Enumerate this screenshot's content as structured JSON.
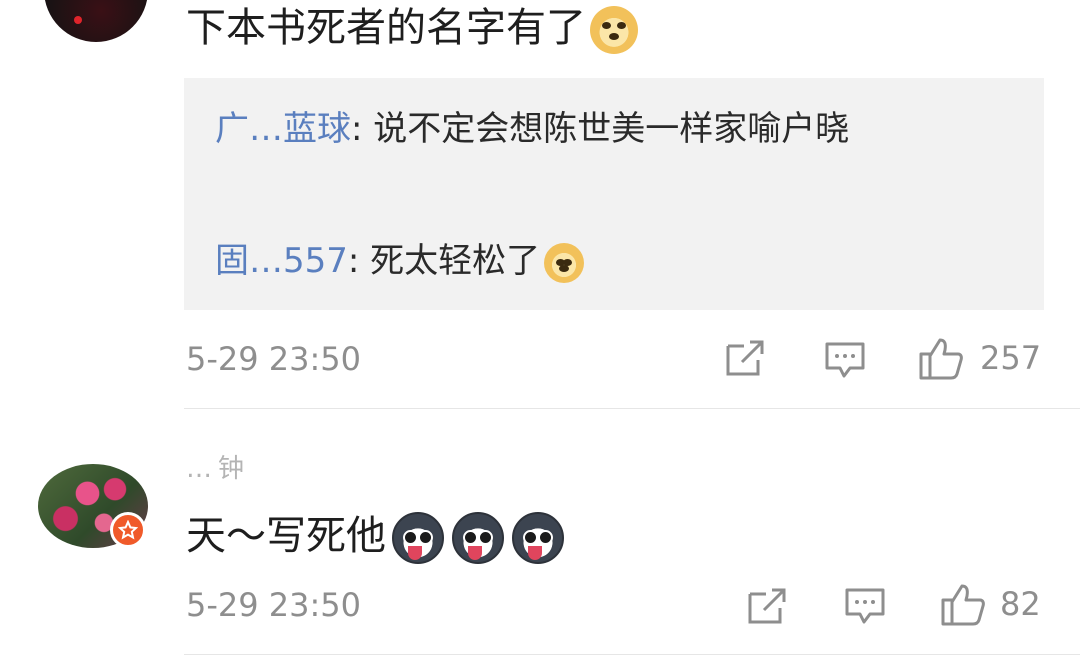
{
  "comments": [
    {
      "text": "下本书死者的名字有了",
      "emoji": "doge-icon",
      "replies": [
        {
          "user": "广…蓝球",
          "text": "说不定会想陈世美一样家喻户晓"
        },
        {
          "user": "固…557",
          "text": "死太轻松了",
          "emoji": "doge-icon"
        }
      ],
      "time": "5-29 23:50",
      "likes": "257"
    },
    {
      "user": "…钟",
      "text": "天～写死他",
      "emojis": [
        "husky-icon",
        "husky-icon",
        "husky-icon"
      ],
      "time": "5-29 23:50",
      "likes": "82"
    }
  ],
  "colors": {
    "username": "#5a7fbf",
    "meta": "#8e8e8e",
    "reply_bg": "#f2f2f2",
    "badge": "#f05a2a"
  }
}
